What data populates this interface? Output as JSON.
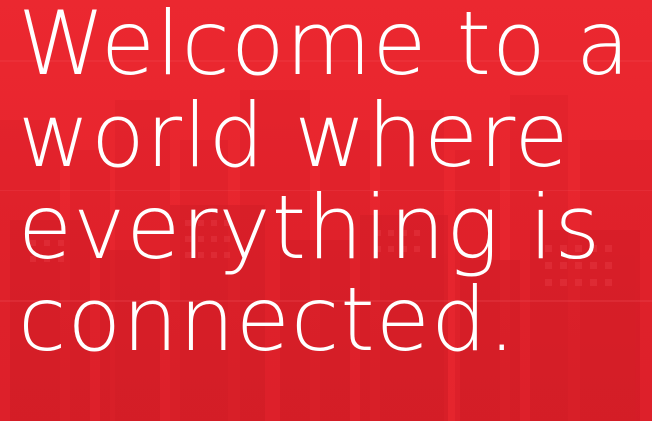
{
  "hero": {
    "headline_lines": [
      "Welcome to a",
      "world where",
      "everything is",
      "connected."
    ],
    "background_image": "red-tinted-city-skyline",
    "colors": {
      "background": "#e3242f",
      "text": "#ffffff"
    }
  }
}
